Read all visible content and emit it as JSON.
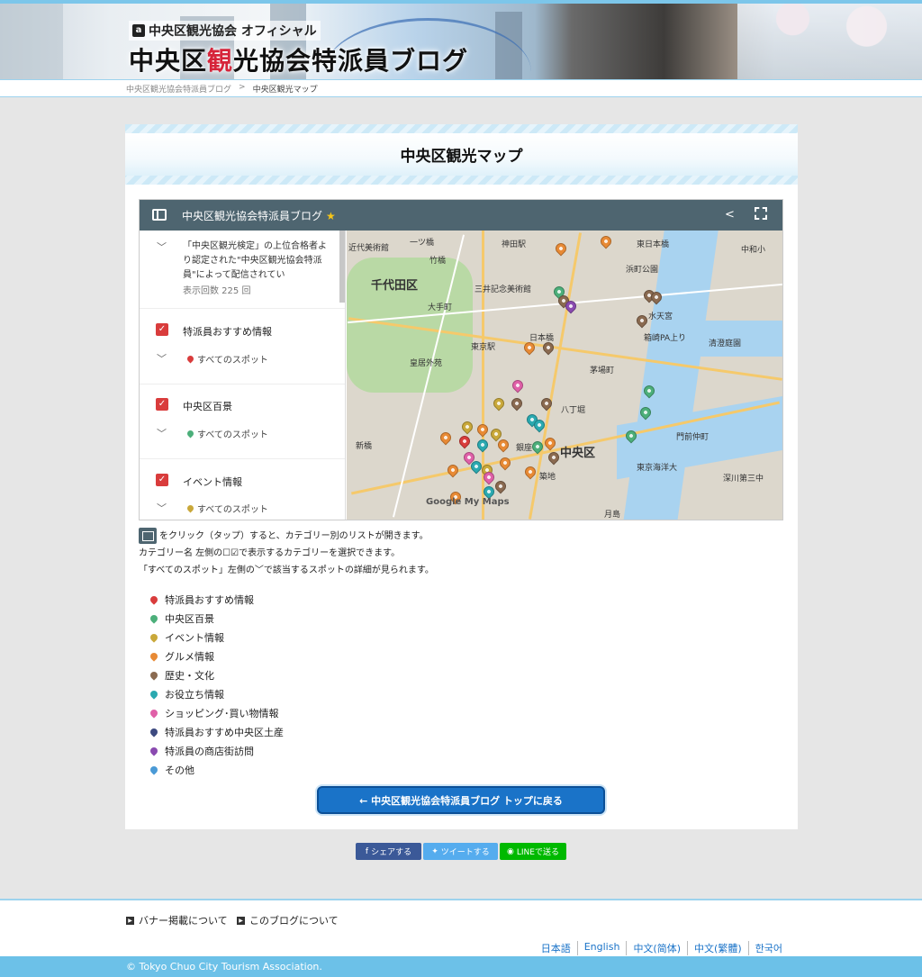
{
  "header": {
    "brand_small": "中央区観光協会 オフィシャル",
    "brand_title_pre": "中央区",
    "brand_title_red": "観",
    "brand_title_post": "光協会特派員ブログ"
  },
  "breadcrumb": {
    "home": "中央区観光協会特派員ブログ",
    "sep": ">",
    "current": "中央区観光マップ"
  },
  "card": {
    "title": "中央区観光マップ"
  },
  "map": {
    "title": "中央区観光協会特派員ブログ",
    "description": "「中央区観光検定」の上位合格者より認定された\"中央区観光協会特派員\"によって配信されてい",
    "view_count": "表示回数 225 回",
    "layers": [
      {
        "label": "特派員おすすめ情報",
        "sub": "すべてのスポット",
        "color": "#d93c3c"
      },
      {
        "label": "中央区百景",
        "sub": "すべてのスポット",
        "color": "#4caf7a"
      },
      {
        "label": "イベント情報",
        "sub": "すべてのスポット",
        "color": "#c9a83a"
      }
    ],
    "labels": {
      "chiyoda": "千代田区",
      "chuo": "中央区",
      "kinshicho": "近代美術館",
      "hitotsubashi": "一ツ橋",
      "kanda": "神田駅",
      "higashinihonbashi": "東日本橋",
      "nakanohashi": "中和小",
      "takebashi": "竹橋",
      "ogawamachi": "大手町",
      "mitsui": "三井記念美術館",
      "hamacho": "浜町公園",
      "kyobashi": "東京駅",
      "suitengu": "水天宮",
      "nihonbashi": "日本橋",
      "kayabacho": "茅場町",
      "ginza": "銀座",
      "tsukiji": "築地",
      "tsukishima": "月島",
      "hakozaki": "箱崎PA上り",
      "kiyosumi": "清澄庭園",
      "monzen": "門前仲町",
      "hatchobori": "八丁堀",
      "shinbashi": "新橋",
      "kaigan": "東京海洋大",
      "fukagawa": "深川第三中",
      "imperial": "皇居外苑",
      "google": "Google My Maps"
    }
  },
  "instructions": {
    "line1": "をクリック（タップ）すると、カテゴリー別のリストが開きます。",
    "line2": "カテゴリー名 左側の☐☑で表示するカテゴリーを選択できます。",
    "line3": "「すべてのスポット」左側の﹀で該当するスポットの詳細が見られます。"
  },
  "legend": [
    {
      "label": "特派員おすすめ情報",
      "color": "#d93c3c"
    },
    {
      "label": "中央区百景",
      "color": "#4caf7a"
    },
    {
      "label": "イベント情報",
      "color": "#c9a83a"
    },
    {
      "label": "グルメ情報",
      "color": "#e88a35"
    },
    {
      "label": "歴史・文化",
      "color": "#8a6a50"
    },
    {
      "label": "お役立ち情報",
      "color": "#2aa9b0"
    },
    {
      "label": "ショッピング･買い物情報",
      "color": "#e060a8"
    },
    {
      "label": "特派員おすすめ中央区土産",
      "color": "#3d4a80"
    },
    {
      "label": "特派員の商店街訪問",
      "color": "#8a4ab0"
    },
    {
      "label": "その他",
      "color": "#4a9ad6"
    }
  ],
  "back_button": "← 中央区観光協会特派員ブログ トップに戻る",
  "social": {
    "facebook": "シェアする",
    "twitter": "ツイートする",
    "line": "LINEで送る"
  },
  "footer": {
    "banner_link": "バナー掲載について",
    "about_link": "このブログについて",
    "languages": [
      "日本語",
      "English",
      "中文(简体)",
      "中文(繁體)",
      "한국어"
    ],
    "copyright": "© Tokyo Chuo City Tourism Association."
  },
  "colors": {
    "accent": "#1a73c8",
    "topbar": "#7cc6ea",
    "map_bar": "#4e6570",
    "facebook": "#3b5998",
    "twitter": "#55acee",
    "line": "#00b900"
  }
}
